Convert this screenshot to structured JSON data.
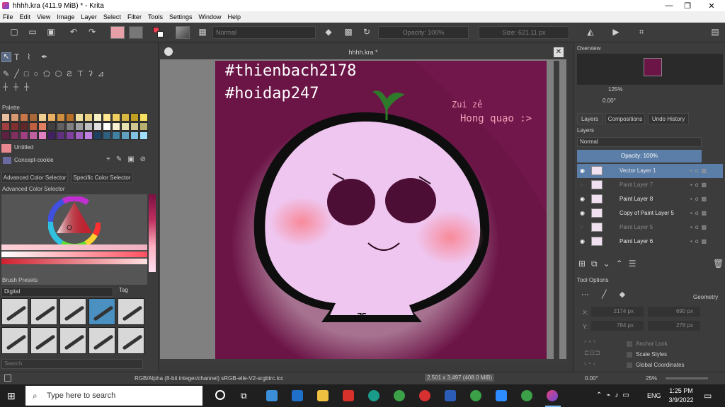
{
  "window": {
    "title": "hhhh.kra (411.9 MiB) * - Krita"
  },
  "menu": [
    "File",
    "Edit",
    "View",
    "Image",
    "Layer",
    "Select",
    "Filter",
    "Tools",
    "Settings",
    "Window",
    "Help"
  ],
  "toolbar": {
    "blend_mode": "Normal",
    "opacity": "Opacity: 100%",
    "size": "Size: 621.11 px"
  },
  "left": {
    "palette_title": "Palette",
    "palette_name": "Untitled",
    "palette_set": "Concept-cookie",
    "tabs": [
      "Advanced Color Selector",
      "Specific Color Selector"
    ],
    "adv_title": "Advanced Color Selector",
    "brush_title": "Brush Presets",
    "brush_filter": "Digital",
    "brush_tag": "Tag",
    "search_placeholder": "Search"
  },
  "document": {
    "tab_title": "hhhh.kra *"
  },
  "artwork": {
    "hashtag1": "#thienbach2178",
    "hashtag2": "#hoidap247",
    "caption1": "Zui zẻ",
    "caption2": "Hong quạo :>",
    "mouth_text": "ᄀᄃ"
  },
  "right": {
    "overview_title": "Overview",
    "zoom": "125%",
    "rotation": "0.00°",
    "tabs": [
      "Layers",
      "Compositions",
      "Undo History"
    ],
    "layers_title": "Layers",
    "blend": "Normal",
    "opacity": "Opacity:  100%",
    "layers": [
      {
        "name": "Vector Layer 1",
        "visible": true,
        "selected": true
      },
      {
        "name": "Paint Layer 7",
        "visible": false,
        "selected": false
      },
      {
        "name": "Paint Layer 8",
        "visible": true,
        "selected": false
      },
      {
        "name": "Copy of Paint Layer 5",
        "visible": true,
        "selected": false
      },
      {
        "name": "Paint Layer 5",
        "visible": false,
        "selected": false
      },
      {
        "name": "Paint Layer 6",
        "visible": true,
        "selected": false
      }
    ],
    "tool_options_title": "Tool Options",
    "geometry": "Geometry",
    "x_val": "2174 px",
    "x_val2": "690 px",
    "y_val": "784 px",
    "y_val2": "276 px",
    "anchor_lock": "Anchor Lock",
    "scale_styles": "Scale Styles",
    "global_coords": "Global Coordinates"
  },
  "status": {
    "color_info": "RGB/Alpha (8-bit integer/channel)   sRGB-elle-V2-srgbtrc.icc",
    "dimensions": "2,501 x 3,497 (408.0 MiB)",
    "rotation": "0.00°",
    "zoom": "25%"
  },
  "taskbar": {
    "search_placeholder": "Type here to search",
    "time": "1:25 PM",
    "date": "3/9/2022",
    "lang": "ENG"
  },
  "colors": {
    "canvas_bg": "#6b1446",
    "head_fill": "#efc6ef",
    "blush": "#f5a0b0",
    "eye": "#4d0e35"
  }
}
